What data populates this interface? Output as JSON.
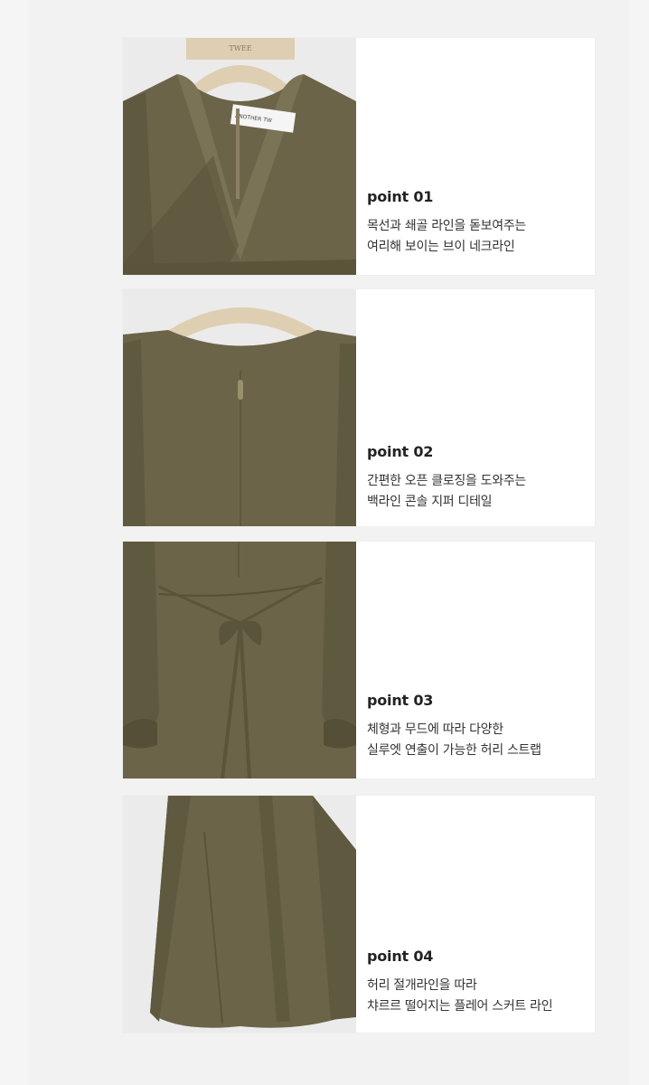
{
  "points": [
    {
      "title": "point 01",
      "lines": [
        "목선과 쇄골 라인을 돋보여주는",
        "여리해 보이는 브이 네크라인"
      ],
      "hanger_text": "TWEE",
      "tag_text": "ANOTHER TW"
    },
    {
      "title": "point 02",
      "lines": [
        "간편한 오픈 클로징을 도와주는",
        "백라인 콘솔 지퍼 디테일"
      ]
    },
    {
      "title": "point 03",
      "lines": [
        "체형과 무드에 따라 다양한",
        "실루엣 연출이 가능한 허리 스트랩"
      ]
    },
    {
      "title": "point 04",
      "lines": [
        "허리 절개라인을 따라",
        "챠르르 떨어지는 플레어 스커트 라인"
      ]
    }
  ],
  "colors": {
    "fabric": "#6b6449",
    "fabric_dark": "#565039",
    "fabric_light": "#7a7356",
    "hanger": "#dfcfb2",
    "background": "#f2f2f2"
  }
}
